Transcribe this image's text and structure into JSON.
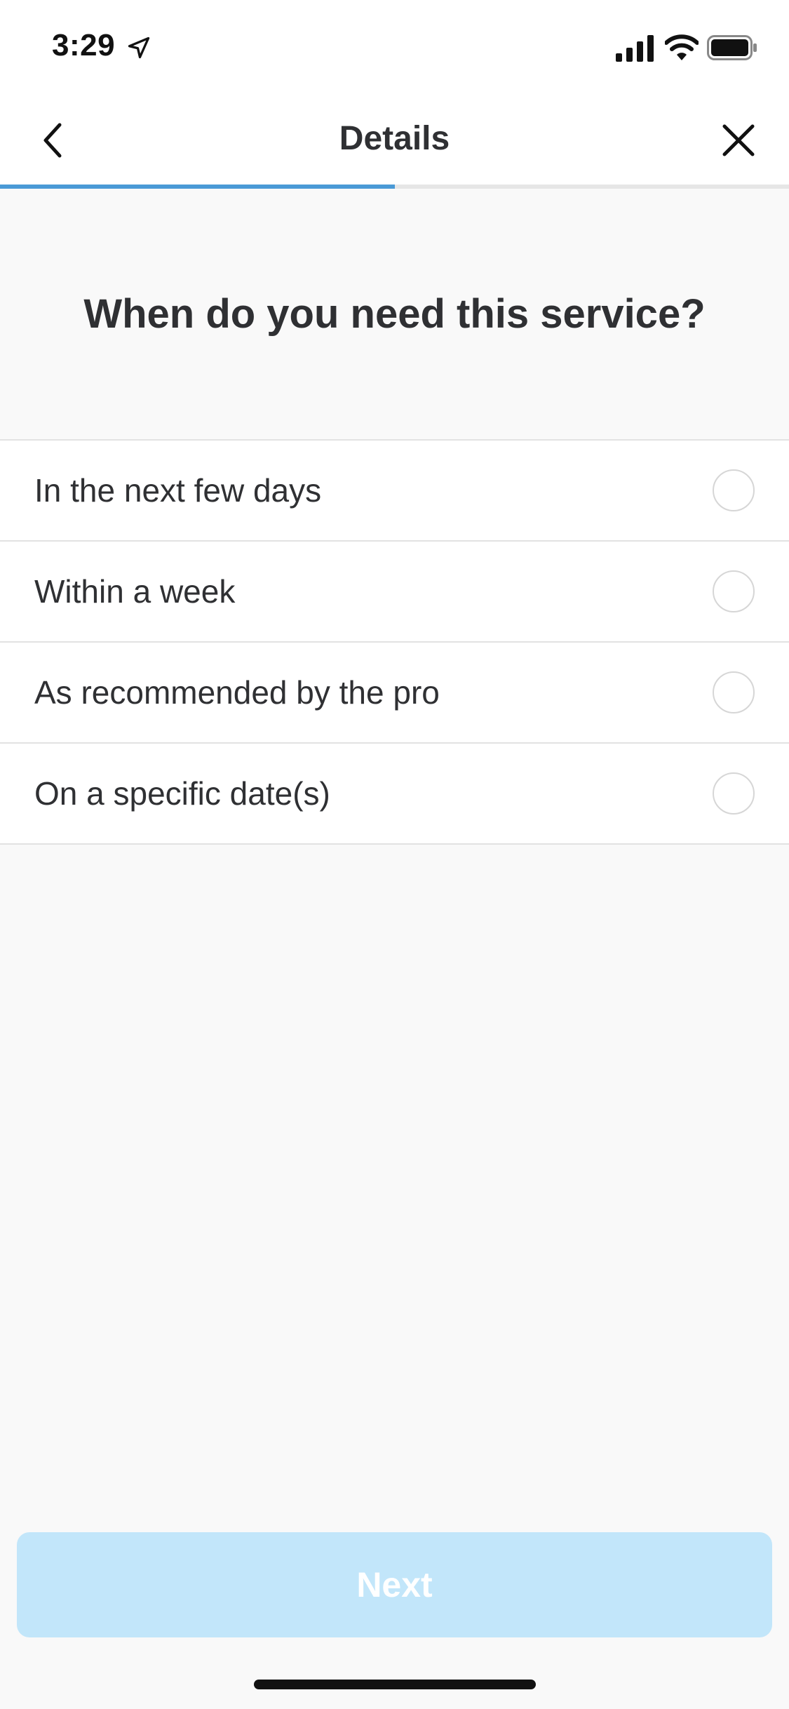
{
  "status_bar": {
    "time": "3:29",
    "icons": [
      "location-arrow-icon",
      "cellular-signal-icon",
      "wifi-icon",
      "battery-icon"
    ]
  },
  "nav": {
    "title": "Details",
    "back_icon": "chevron-left-icon",
    "close_icon": "close-icon"
  },
  "progress": {
    "fraction": 0.5,
    "color": "#4a9ad6"
  },
  "question": "When do you need this service?",
  "options": [
    {
      "label": "In the next few days",
      "selected": false
    },
    {
      "label": "Within a week",
      "selected": false
    },
    {
      "label": "As recommended by the pro",
      "selected": false
    },
    {
      "label": "On a specific date(s)",
      "selected": false
    }
  ],
  "next_button": {
    "label": "Next",
    "enabled": false,
    "color": "#c2e6fa"
  }
}
